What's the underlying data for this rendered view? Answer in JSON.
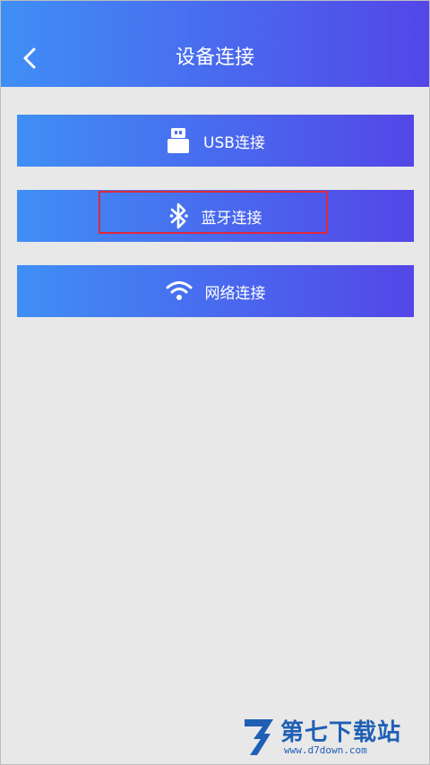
{
  "header": {
    "title": "设备连接",
    "back_icon": "chevron-left-icon"
  },
  "connections": [
    {
      "label": "USB连接",
      "icon": "usb-icon"
    },
    {
      "label": "蓝牙连接",
      "icon": "bluetooth-icon"
    },
    {
      "label": "网络连接",
      "icon": "wifi-icon"
    }
  ],
  "watermark": {
    "name": "第七下载站",
    "url": "www.d7down.com"
  },
  "colors": {
    "gradient_start": "#3f8ff5",
    "gradient_end": "#5346e8",
    "background": "#e8e8e8",
    "highlight": "#e0283c",
    "watermark": "#1f5fb5"
  }
}
